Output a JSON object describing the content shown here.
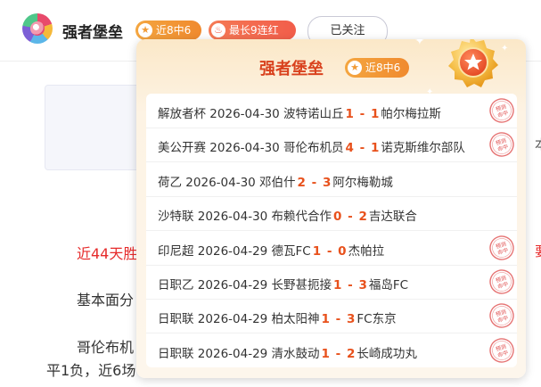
{
  "header": {
    "name": "强者堡垒",
    "badge_win": "近8中6",
    "badge_streak": "最长9连红",
    "follow_label": "已关注"
  },
  "background": {
    "line1_red": "近44天胜",
    "line2": "基本面分",
    "line3": "哥伦布机",
    "line4": "平1负，近6场",
    "right1": "要",
    "right2": "本"
  },
  "popup": {
    "title": "强者堡垒",
    "badge": "近8中6",
    "stamp_text": "预测命中",
    "rows": [
      {
        "league": "解放者杯",
        "date": "2026-04-30",
        "home": "波特诺山丘",
        "hs": "1",
        "as": "1",
        "away": "帕尔梅拉斯",
        "hit": true
      },
      {
        "league": "美公开赛",
        "date": "2026-04-30",
        "home": "哥伦布机员",
        "hs": "4",
        "as": "1",
        "away": "诺克斯维尔部队",
        "hit": true
      },
      {
        "league": "荷乙",
        "date": "2026-04-30",
        "home": "邓伯什",
        "hs": "2",
        "as": "3",
        "away": "阿尔梅勒城",
        "hit": false
      },
      {
        "league": "沙特联",
        "date": "2026-04-30",
        "home": "布赖代合作",
        "hs": "0",
        "as": "2",
        "away": "吉达联合",
        "hit": false
      },
      {
        "league": "印尼超",
        "date": "2026-04-29",
        "home": "德瓦FC",
        "hs": "1",
        "as": "0",
        "away": "杰帕拉",
        "hit": true
      },
      {
        "league": "日职乙",
        "date": "2026-04-29",
        "home": "长野甚扼接",
        "hs": "1",
        "as": "3",
        "away": "福岛FC",
        "hit": true
      },
      {
        "league": "日职联",
        "date": "2026-04-29",
        "home": "柏太阳神",
        "hs": "1",
        "as": "3",
        "away": "FC东京",
        "hit": true
      },
      {
        "league": "日职联",
        "date": "2026-04-29",
        "home": "清水鼓动",
        "hs": "1",
        "as": "2",
        "away": "长崎成功丸",
        "hit": true
      }
    ]
  },
  "colors": {
    "accent": "#e8511c",
    "title": "#d9421e",
    "badge": "#f08a2e",
    "streak": "#f25d4a",
    "stamp": "#e05050"
  }
}
